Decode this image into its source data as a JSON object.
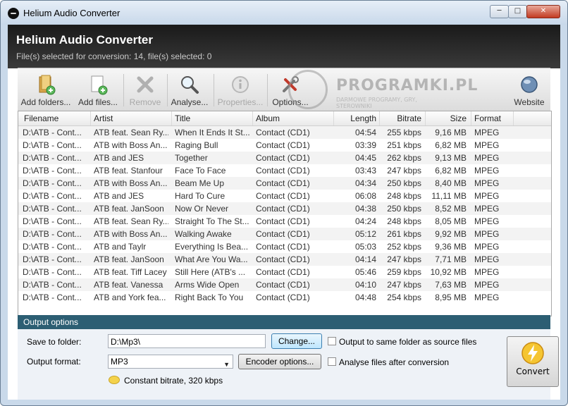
{
  "window": {
    "title": "Helium Audio Converter"
  },
  "header": {
    "title": "Helium Audio Converter",
    "status": "File(s) selected for conversion: 14, file(s) selected: 0"
  },
  "toolbar": {
    "add_folders": "Add folders...",
    "add_files": "Add files...",
    "remove": "Remove",
    "analyse": "Analyse...",
    "properties": "Properties...",
    "options": "Options...",
    "website": "Website"
  },
  "watermark": {
    "text": "PROGRAMKI.PL",
    "subtitle": "DARMOWE PROGRAMY, GRY, STEROWNIKI"
  },
  "columns": [
    "Filename",
    "Artist",
    "Title",
    "Album",
    "Length",
    "Bitrate",
    "Size",
    "Format"
  ],
  "rows": [
    {
      "filename": "D:\\ATB - Cont...",
      "artist": "ATB feat. Sean Ry...",
      "title": "When It Ends It St...",
      "album": "Contact (CD1)",
      "length": "04:54",
      "bitrate": "255 kbps",
      "size": "9,16 MB",
      "format": "MPEG"
    },
    {
      "filename": "D:\\ATB - Cont...",
      "artist": "ATB with Boss An...",
      "title": "Raging Bull",
      "album": "Contact (CD1)",
      "length": "03:39",
      "bitrate": "251 kbps",
      "size": "6,82 MB",
      "format": "MPEG"
    },
    {
      "filename": "D:\\ATB - Cont...",
      "artist": "ATB and JES",
      "title": "Together",
      "album": "Contact (CD1)",
      "length": "04:45",
      "bitrate": "262 kbps",
      "size": "9,13 MB",
      "format": "MPEG"
    },
    {
      "filename": "D:\\ATB - Cont...",
      "artist": "ATB feat. Stanfour",
      "title": "Face To Face",
      "album": "Contact (CD1)",
      "length": "03:43",
      "bitrate": "247 kbps",
      "size": "6,82 MB",
      "format": "MPEG"
    },
    {
      "filename": "D:\\ATB - Cont...",
      "artist": "ATB with Boss An...",
      "title": "Beam Me Up",
      "album": "Contact (CD1)",
      "length": "04:34",
      "bitrate": "250 kbps",
      "size": "8,40 MB",
      "format": "MPEG"
    },
    {
      "filename": "D:\\ATB - Cont...",
      "artist": "ATB and JES",
      "title": "Hard To Cure",
      "album": "Contact (CD1)",
      "length": "06:08",
      "bitrate": "248 kbps",
      "size": "11,11 MB",
      "format": "MPEG"
    },
    {
      "filename": "D:\\ATB - Cont...",
      "artist": "ATB feat. JanSoon",
      "title": "Now Or Never",
      "album": "Contact (CD1)",
      "length": "04:38",
      "bitrate": "250 kbps",
      "size": "8,52 MB",
      "format": "MPEG"
    },
    {
      "filename": "D:\\ATB - Cont...",
      "artist": "ATB feat. Sean Ry...",
      "title": "Straight To The St...",
      "album": "Contact (CD1)",
      "length": "04:24",
      "bitrate": "248 kbps",
      "size": "8,05 MB",
      "format": "MPEG"
    },
    {
      "filename": "D:\\ATB - Cont...",
      "artist": "ATB with Boss An...",
      "title": "Walking Awake",
      "album": "Contact (CD1)",
      "length": "05:12",
      "bitrate": "261 kbps",
      "size": "9,92 MB",
      "format": "MPEG"
    },
    {
      "filename": "D:\\ATB - Cont...",
      "artist": "ATB and Taylr",
      "title": "Everything Is Bea...",
      "album": "Contact (CD1)",
      "length": "05:03",
      "bitrate": "252 kbps",
      "size": "9,36 MB",
      "format": "MPEG"
    },
    {
      "filename": "D:\\ATB - Cont...",
      "artist": "ATB feat. JanSoon",
      "title": "What Are You Wa...",
      "album": "Contact (CD1)",
      "length": "04:14",
      "bitrate": "247 kbps",
      "size": "7,71 MB",
      "format": "MPEG"
    },
    {
      "filename": "D:\\ATB - Cont...",
      "artist": "ATB feat. Tiff Lacey",
      "title": "Still Here (ATB's ...",
      "album": "Contact (CD1)",
      "length": "05:46",
      "bitrate": "259 kbps",
      "size": "10,92 MB",
      "format": "MPEG"
    },
    {
      "filename": "D:\\ATB - Cont...",
      "artist": "ATB feat. Vanessa",
      "title": "Arms Wide Open",
      "album": "Contact (CD1)",
      "length": "04:10",
      "bitrate": "247 kbps",
      "size": "7,63 MB",
      "format": "MPEG"
    },
    {
      "filename": "D:\\ATB - Cont...",
      "artist": "ATB and York fea...",
      "title": "Right Back To You",
      "album": "Contact (CD1)",
      "length": "04:48",
      "bitrate": "254 kbps",
      "size": "8,95 MB",
      "format": "MPEG"
    }
  ],
  "output": {
    "title": "Output options",
    "save_label": "Save to folder:",
    "save_value": "D:\\Mp3\\",
    "change_label": "Change...",
    "same_folder_label": "Output to same folder as source files",
    "format_label": "Output format:",
    "format_value": "MP3",
    "encoder_label": "Encoder options...",
    "analyse_label": "Analyse files after conversion",
    "bitrate_info": "Constant bitrate, 320 kbps",
    "convert_label": "Convert"
  }
}
